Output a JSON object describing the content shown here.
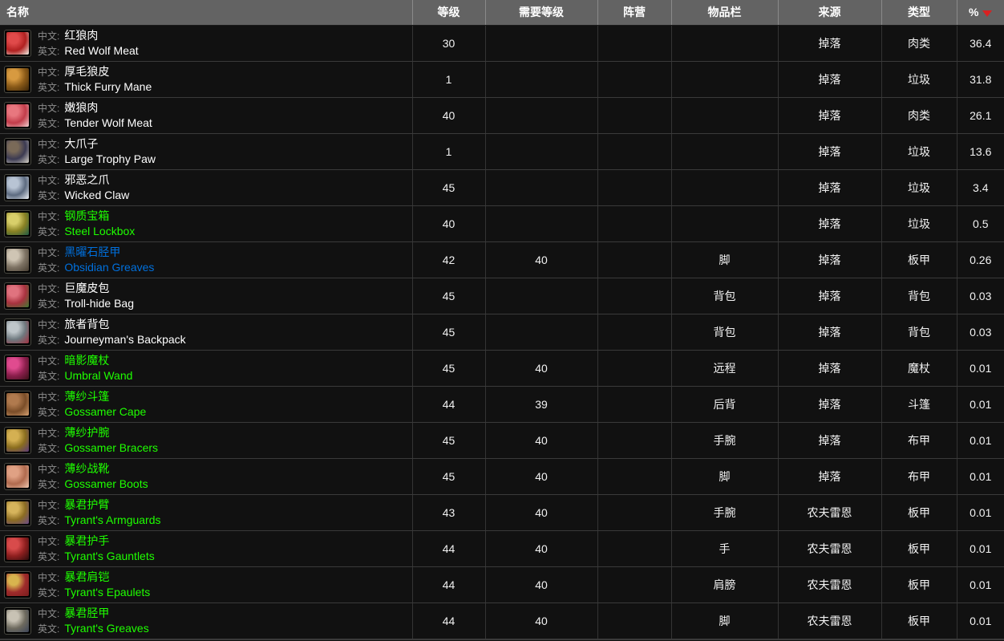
{
  "table": {
    "columns": [
      {
        "key": "name",
        "label": "名称",
        "name": "column-header-name"
      },
      {
        "key": "level",
        "label": "等级",
        "name": "column-header-level"
      },
      {
        "key": "req_level",
        "label": "需要等级",
        "name": "column-header-required-level"
      },
      {
        "key": "faction",
        "label": "阵营",
        "name": "column-header-faction"
      },
      {
        "key": "slot",
        "label": "物品栏",
        "name": "column-header-slot"
      },
      {
        "key": "source",
        "label": "来源",
        "name": "column-header-source"
      },
      {
        "key": "type",
        "label": "类型",
        "name": "column-header-type"
      },
      {
        "key": "percent",
        "label": "%",
        "name": "column-header-percent"
      }
    ],
    "sort": {
      "column": "percent",
      "direction": "desc",
      "arrow_color": "#d92121"
    },
    "labels": {
      "chinese": "中文:",
      "english": "英文:"
    },
    "quality_colors": {
      "common": "#ffffff",
      "uncommon": "#1eff00",
      "rare": "#0070dd"
    },
    "rows": [
      {
        "icon": "red-wolf-meat-icon",
        "icon_colors": [
          "#e04a4a",
          "#b02020",
          "#f2f2e8"
        ],
        "name_zh": "红狼肉",
        "name_en": "Red Wolf Meat",
        "quality": "common",
        "level": "30",
        "req_level": "",
        "faction": "",
        "slot": "",
        "source": "掉落",
        "type": "肉类",
        "percent": "36.4"
      },
      {
        "icon": "thick-furry-mane-icon",
        "icon_colors": [
          "#d79a40",
          "#8a5a18",
          "#3a2408"
        ],
        "name_zh": "厚毛狼皮",
        "name_en": "Thick Furry Mane",
        "quality": "common",
        "level": "1",
        "req_level": "",
        "faction": "",
        "slot": "",
        "source": "掉落",
        "type": "垃圾",
        "percent": "31.8"
      },
      {
        "icon": "tender-wolf-meat-icon",
        "icon_colors": [
          "#e8777f",
          "#c23c4a",
          "#f0d0d0"
        ],
        "name_zh": "嫩狼肉",
        "name_en": "Tender Wolf Meat",
        "quality": "common",
        "level": "40",
        "req_level": "",
        "faction": "",
        "slot": "",
        "source": "掉落",
        "type": "肉类",
        "percent": "26.1"
      },
      {
        "icon": "large-trophy-paw-icon",
        "icon_colors": [
          "#7a6a58",
          "#3b3a52",
          "#d8d4c8"
        ],
        "name_zh": "大爪子",
        "name_en": "Large Trophy Paw",
        "quality": "common",
        "level": "1",
        "req_level": "",
        "faction": "",
        "slot": "",
        "source": "掉落",
        "type": "垃圾",
        "percent": "13.6"
      },
      {
        "icon": "wicked-claw-icon",
        "icon_colors": [
          "#b8c4d4",
          "#5d6b80",
          "#eef2f7"
        ],
        "name_zh": "邪恶之爪",
        "name_en": "Wicked Claw",
        "quality": "common",
        "level": "45",
        "req_level": "",
        "faction": "",
        "slot": "",
        "source": "掉落",
        "type": "垃圾",
        "percent": "3.4"
      },
      {
        "icon": "steel-lockbox-icon",
        "icon_colors": [
          "#d8cf6a",
          "#8a8224",
          "#1d5a44"
        ],
        "name_zh": "钢质宝箱",
        "name_en": "Steel Lockbox",
        "quality": "uncommon",
        "level": "40",
        "req_level": "",
        "faction": "",
        "slot": "",
        "source": "掉落",
        "type": "垃圾",
        "percent": "0.5"
      },
      {
        "icon": "obsidian-greaves-icon",
        "icon_colors": [
          "#cfc5b4",
          "#7e7364",
          "#453c30"
        ],
        "name_zh": "黑曜石胫甲",
        "name_en": "Obsidian Greaves",
        "quality": "rare",
        "level": "42",
        "req_level": "40",
        "faction": "",
        "slot": "脚",
        "source": "掉落",
        "type": "板甲",
        "percent": "0.26"
      },
      {
        "icon": "troll-hide-bag-icon",
        "icon_colors": [
          "#e0737f",
          "#a8323f",
          "#3f7a32"
        ],
        "name_zh": "巨魔皮包",
        "name_en": "Troll-hide Bag",
        "quality": "common",
        "level": "45",
        "req_level": "",
        "faction": "",
        "slot": "背包",
        "source": "掉落",
        "type": "背包",
        "percent": "0.03"
      },
      {
        "icon": "journeymans-backpack-icon",
        "icon_colors": [
          "#bfc6ca",
          "#6f797f",
          "#a03040"
        ],
        "name_zh": "旅者背包",
        "name_en": "Journeyman's Backpack",
        "quality": "common",
        "level": "45",
        "req_level": "",
        "faction": "",
        "slot": "背包",
        "source": "掉落",
        "type": "背包",
        "percent": "0.03"
      },
      {
        "icon": "umbral-wand-icon",
        "icon_colors": [
          "#e04b8f",
          "#8c1f4d",
          "#3b1018"
        ],
        "name_zh": "暗影魔杖",
        "name_en": "Umbral Wand",
        "quality": "uncommon",
        "level": "45",
        "req_level": "40",
        "faction": "",
        "slot": "远程",
        "source": "掉落",
        "type": "魔杖",
        "percent": "0.01"
      },
      {
        "icon": "gossamer-cape-icon",
        "icon_colors": [
          "#b07a4e",
          "#7a4d28",
          "#d6a070"
        ],
        "name_zh": "薄纱斗篷",
        "name_en": "Gossamer Cape",
        "quality": "uncommon",
        "level": "44",
        "req_level": "39",
        "faction": "",
        "slot": "后背",
        "source": "掉落",
        "type": "斗篷",
        "percent": "0.01"
      },
      {
        "icon": "gossamer-bracers-icon",
        "icon_colors": [
          "#d4b052",
          "#8a6d1e",
          "#5b3a7a"
        ],
        "name_zh": "薄纱护腕",
        "name_en": "Gossamer Bracers",
        "quality": "uncommon",
        "level": "45",
        "req_level": "40",
        "faction": "",
        "slot": "手腕",
        "source": "掉落",
        "type": "布甲",
        "percent": "0.01"
      },
      {
        "icon": "gossamer-boots-icon",
        "icon_colors": [
          "#e0a184",
          "#b06a4e",
          "#f0c8b0"
        ],
        "name_zh": "薄纱战靴",
        "name_en": "Gossamer Boots",
        "quality": "uncommon",
        "level": "45",
        "req_level": "40",
        "faction": "",
        "slot": "脚",
        "source": "掉落",
        "type": "布甲",
        "percent": "0.01"
      },
      {
        "icon": "tyrants-armguards-icon",
        "icon_colors": [
          "#d6b45c",
          "#8c6c22",
          "#6a4a88"
        ],
        "name_zh": "暴君护臂",
        "name_en": "Tyrant's Armguards",
        "quality": "uncommon",
        "level": "43",
        "req_level": "40",
        "faction": "",
        "slot": "手腕",
        "source": "农夫雷恩",
        "type": "板甲",
        "percent": "0.01"
      },
      {
        "icon": "tyrants-gauntlets-icon",
        "icon_colors": [
          "#d84b4b",
          "#8e1f1f",
          "#2a0c0c"
        ],
        "name_zh": "暴君护手",
        "name_en": "Tyrant's Gauntlets",
        "quality": "uncommon",
        "level": "44",
        "req_level": "40",
        "faction": "",
        "slot": "手",
        "source": "农夫雷恩",
        "type": "板甲",
        "percent": "0.01"
      },
      {
        "icon": "tyrants-epaulets-icon",
        "icon_colors": [
          "#d8b44e",
          "#9e2b2b",
          "#7a1c1c"
        ],
        "name_zh": "暴君肩铠",
        "name_en": "Tyrant's Epaulets",
        "quality": "uncommon",
        "level": "44",
        "req_level": "40",
        "faction": "",
        "slot": "肩膀",
        "source": "农夫雷恩",
        "type": "板甲",
        "percent": "0.01"
      },
      {
        "icon": "tyrants-greaves-icon",
        "icon_colors": [
          "#c8c2b4",
          "#6e6a5e",
          "#3b4458"
        ],
        "name_zh": "暴君胫甲",
        "name_en": "Tyrant's Greaves",
        "quality": "uncommon",
        "level": "44",
        "req_level": "40",
        "faction": "",
        "slot": "脚",
        "source": "农夫雷恩",
        "type": "板甲",
        "percent": "0.01"
      }
    ]
  }
}
